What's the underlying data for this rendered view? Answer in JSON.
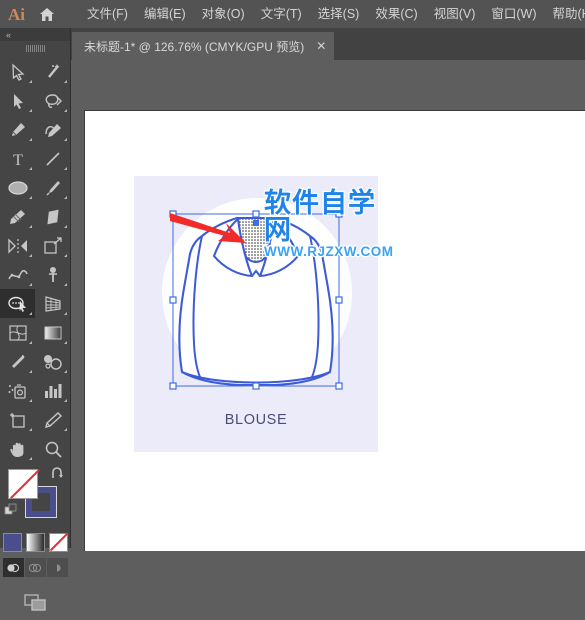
{
  "app": {
    "logo_text": "Ai",
    "home_icon": "home-icon"
  },
  "menubar": {
    "items": [
      {
        "label": "文件(F)",
        "name": "menu-file"
      },
      {
        "label": "编辑(E)",
        "name": "menu-edit"
      },
      {
        "label": "对象(O)",
        "name": "menu-object"
      },
      {
        "label": "文字(T)",
        "name": "menu-type"
      },
      {
        "label": "选择(S)",
        "name": "menu-select"
      },
      {
        "label": "效果(C)",
        "name": "menu-effect"
      },
      {
        "label": "视图(V)",
        "name": "menu-view"
      },
      {
        "label": "窗口(W)",
        "name": "menu-window"
      },
      {
        "label": "帮助(H)",
        "name": "menu-help"
      }
    ]
  },
  "tab": {
    "title": "未标题-1* @ 126.76% (CMYK/GPU 预览)",
    "close_label": "✕",
    "document_name": "未标题-1*",
    "zoom_level": "126.76%",
    "color_mode": "CMYK/GPU 预览"
  },
  "toolbar": {
    "collapse_label": "«",
    "tools": [
      {
        "name": "selection-tool",
        "icon": "selection-arrow-icon",
        "active": false
      },
      {
        "name": "magic-wand-tool",
        "icon": "magic-wand-icon",
        "active": false
      },
      {
        "name": "direct-selection-tool",
        "icon": "direct-selection-arrow-icon",
        "active": false
      },
      {
        "name": "lasso-tool",
        "icon": "lasso-icon",
        "active": false
      },
      {
        "name": "pen-tool",
        "icon": "pen-icon",
        "active": false
      },
      {
        "name": "curvature-tool",
        "icon": "curvature-icon",
        "active": false
      },
      {
        "name": "type-tool",
        "icon": "type-t-icon",
        "active": false
      },
      {
        "name": "line-segment-tool",
        "icon": "line-segment-icon",
        "active": false
      },
      {
        "name": "ellipse-tool",
        "icon": "ellipse-icon",
        "active": false
      },
      {
        "name": "paintbrush-tool",
        "icon": "paintbrush-icon",
        "active": false
      },
      {
        "name": "shaper-pencil-tool",
        "icon": "pencil-icon",
        "active": false
      },
      {
        "name": "eraser-tool",
        "icon": "eraser-icon",
        "active": false
      },
      {
        "name": "reflect-rotate-tool",
        "icon": "reflect-icon",
        "active": false
      },
      {
        "name": "scale-tool",
        "icon": "scale-icon",
        "active": false
      },
      {
        "name": "width-warp-tool",
        "icon": "warp-icon",
        "active": false
      },
      {
        "name": "free-transform-tool",
        "icon": "pushpin-icon",
        "active": false
      },
      {
        "name": "shape-builder-tool",
        "icon": "shape-builder-icon",
        "active": true
      },
      {
        "name": "perspective-grid-tool",
        "icon": "perspective-grid-icon",
        "active": false
      },
      {
        "name": "mesh-tool",
        "icon": "mesh-icon",
        "active": false
      },
      {
        "name": "gradient-tool",
        "icon": "gradient-icon",
        "active": false
      },
      {
        "name": "eyedropper-tool",
        "icon": "eyedropper-icon",
        "active": false
      },
      {
        "name": "blend-tool",
        "icon": "blend-icon",
        "active": false
      },
      {
        "name": "symbol-sprayer-tool",
        "icon": "symbol-sprayer-icon",
        "active": false
      },
      {
        "name": "column-graph-tool",
        "icon": "bar-chart-icon",
        "active": false
      },
      {
        "name": "artboard-tool",
        "icon": "artboard-icon",
        "active": false
      },
      {
        "name": "slice-tool",
        "icon": "slice-knife-icon",
        "active": false
      },
      {
        "name": "hand-tool",
        "icon": "hand-icon",
        "active": false
      },
      {
        "name": "zoom-tool",
        "icon": "magnifier-icon",
        "active": false
      }
    ],
    "fill_stroke": {
      "fill_color": "#ffffff",
      "fill_is_none": true,
      "stroke_color": "#4a4f8c",
      "swap_icon": "swap-arrows-icon",
      "default_icon": "default-fill-stroke-icon"
    },
    "swatch_modes": [
      {
        "name": "flat-color-swatch",
        "label": "颜色",
        "color": "#4a4f8c"
      },
      {
        "name": "gradient-swatch",
        "label": "渐变"
      },
      {
        "name": "none-swatch",
        "label": "无"
      }
    ],
    "draw_modes": [
      {
        "name": "draw-normal-mode",
        "active": true
      },
      {
        "name": "draw-behind-mode",
        "active": false
      },
      {
        "name": "draw-inside-mode",
        "active": false
      }
    ],
    "screen_mode": {
      "name": "change-screen-mode-button",
      "icon": "screen-mode-icon"
    }
  },
  "canvas": {
    "card": {
      "label": "BLOUSE",
      "background_color": "#ebebf9",
      "circle_color": "#ffffff",
      "label_color": "#4c4c7a"
    },
    "artwork": {
      "name": "blouse-illustration",
      "stroke_color": "#3d5bd6",
      "collar_fill": "mesh-dot-pattern",
      "selected": true
    },
    "selection": {
      "bbox_color": "#3d6ee0",
      "handles": 8,
      "anchor_color": "#3d6ee0"
    }
  },
  "watermark": {
    "main": "软件自学网",
    "sub": "WWW.RJZXW.COM",
    "main_color": "#1f84e8",
    "sub_color": "#3aa2f2",
    "arrow_color": "#f02b28",
    "arrow_name": "red-pointer-arrow"
  }
}
